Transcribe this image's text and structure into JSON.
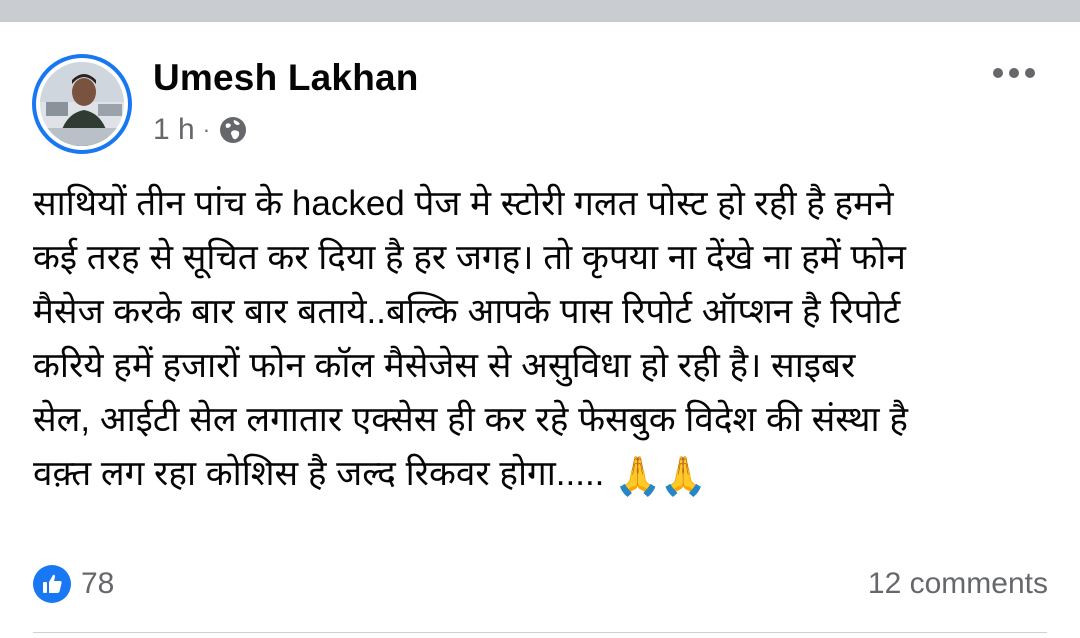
{
  "post": {
    "author": "Umesh Lakhan",
    "time": "1 h",
    "separator": "·",
    "audience_icon": "globe-icon",
    "menu_icon": "more-horizontal-icon",
    "text_lines": [
      "साथियों तीन पांच के hacked पेज मे स्टोरी गलत पोस्ट हो रही है हमने",
      "कई तरह से सूचित कर दिया है हर जगह। तो कृपया ना देंखे ना हमें फोन",
      "मैसेज करके बार बार बताये..बल्कि आपके पास रिपोर्ट ऑप्शन है रिपोर्ट",
      "करिये हमें हजारों फोन कॉल मैसेजेस से असुविधा हो रही है। साइबर",
      "सेल, आईटी सेल लगातार एक्सेस ही कर रहे फेसबुक विदेश की संस्था है",
      "वक़्त लग रहा कोशिस है जल्द रिकवर होगा....."
    ],
    "emoji": "🙏🙏",
    "reactions": {
      "icon": "like-icon",
      "count": "78"
    },
    "comments": "12 comments"
  },
  "colors": {
    "accent": "#1877f2",
    "secondary_text": "#65676b",
    "top_strip": "#c9ccd1"
  }
}
